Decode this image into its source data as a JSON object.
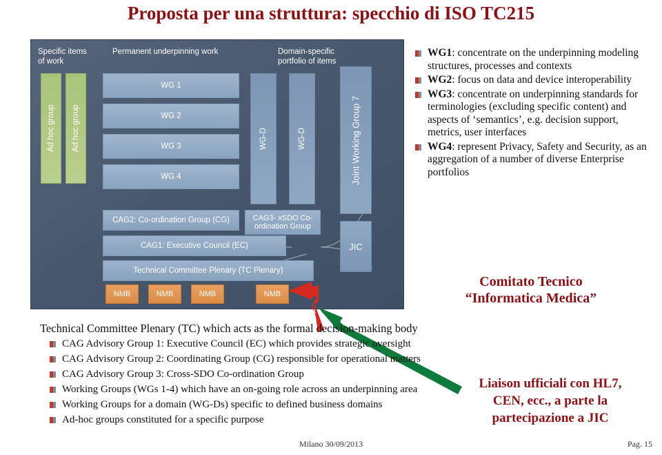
{
  "slide": {
    "title": "Proposta per una struttura: specchio di ISO TC215",
    "footer_date": "Milano 30/09/2013",
    "footer_page": "Pag. 15"
  },
  "diagram": {
    "column_headings": [
      {
        "id": "specific-items",
        "text": "Specific items\nof work"
      },
      {
        "id": "permanent-underpinning",
        "text": "Permanent underpinning work"
      },
      {
        "id": "domain-specific",
        "text": "Domain-specific\nportfolio of  items"
      }
    ],
    "adhoc_boxes": [
      {
        "label": "Ad hoc group"
      },
      {
        "label": "Ad hoc group"
      }
    ],
    "working_groups": [
      {
        "label": "WG 1"
      },
      {
        "label": "WG 2"
      },
      {
        "label": "WG 3"
      },
      {
        "label": "WG 4"
      }
    ],
    "wgd_boxes": [
      {
        "label": "WG-D"
      },
      {
        "label": "WG-D"
      }
    ],
    "joint_working_group": {
      "label": "Joint Working Group 7"
    },
    "jic": {
      "label": "JIC"
    },
    "cag2": {
      "label": "CAG2: Co-ordination Group (CG)"
    },
    "cag3": {
      "label": "CAG3- xSDO Co-ordination Group"
    },
    "cag1": {
      "label": "CAG1: Executive Council (EC)"
    },
    "tc_plenary": {
      "label": "Technical Committee  Plenary (TC Plenary)"
    },
    "nmb_boxes": [
      {
        "label": "NMB"
      },
      {
        "label": "NMB"
      },
      {
        "label": "NMB"
      },
      {
        "label": "NMB"
      }
    ]
  },
  "right_bullets": [
    {
      "segments": [
        {
          "text": "WG1",
          "bold": true
        },
        {
          "text": ": concentrate on the underpinning modeling structures, processes and contexts",
          "bold": false
        }
      ]
    },
    {
      "segments": [
        {
          "text": "WG2",
          "bold": true
        },
        {
          "text": ": focus on data and device interoperability",
          "bold": false
        }
      ]
    },
    {
      "segments": [
        {
          "text": "WG3",
          "bold": true
        },
        {
          "text": ": concentrate on underpinning standards for terminologies (excluding specific content) and aspects of ‘semantics’, e.g. decision support, metrics, user interfaces",
          "bold": false
        }
      ]
    },
    {
      "segments": [
        {
          "text": "WG4",
          "bold": true
        },
        {
          "text": ": represent Privacy, Safety and Security, as an aggregation of a number of diverse Enterprise portfolios",
          "bold": false
        }
      ]
    }
  ],
  "comitato": {
    "line1": "Comitato Tecnico",
    "line2": "“Informatica Medica”"
  },
  "bottom": {
    "lead": "Technical Committee Plenary (TC) which acts as the formal decision-making body",
    "items": [
      "CAG Advisory Group 1: Executive Council (EC) which provides strategic oversight",
      "CAG Advisory Group 2: Coordinating Group (CG) responsible for operational matters",
      "CAG Advisory Group 3: Cross-SDO Co-ordination Group",
      "Working Groups (WGs 1-4) which have an on-going role across an underpinning area",
      "Working Groups for a domain (WG-Ds) specific to defined business domains",
      "Ad-hoc groups constituted for a specific purpose"
    ]
  },
  "liaison": {
    "line1": "Liaison ufficiali con HL7,",
    "line2": "CEN, ecc., a parte la",
    "line3": "partecipazione a JIC"
  },
  "colors": {
    "title_red": "#8B0F13",
    "bullet_red": "#C0392B",
    "bullet_gray": "#7B8BA0",
    "arrow_red": "#D42A1F",
    "arrow_green": "#0E7A3C",
    "panel_bg": "#4a5a6a",
    "nmb_orange": "#DD8C45",
    "adhoc_green": "#A8C47A"
  }
}
